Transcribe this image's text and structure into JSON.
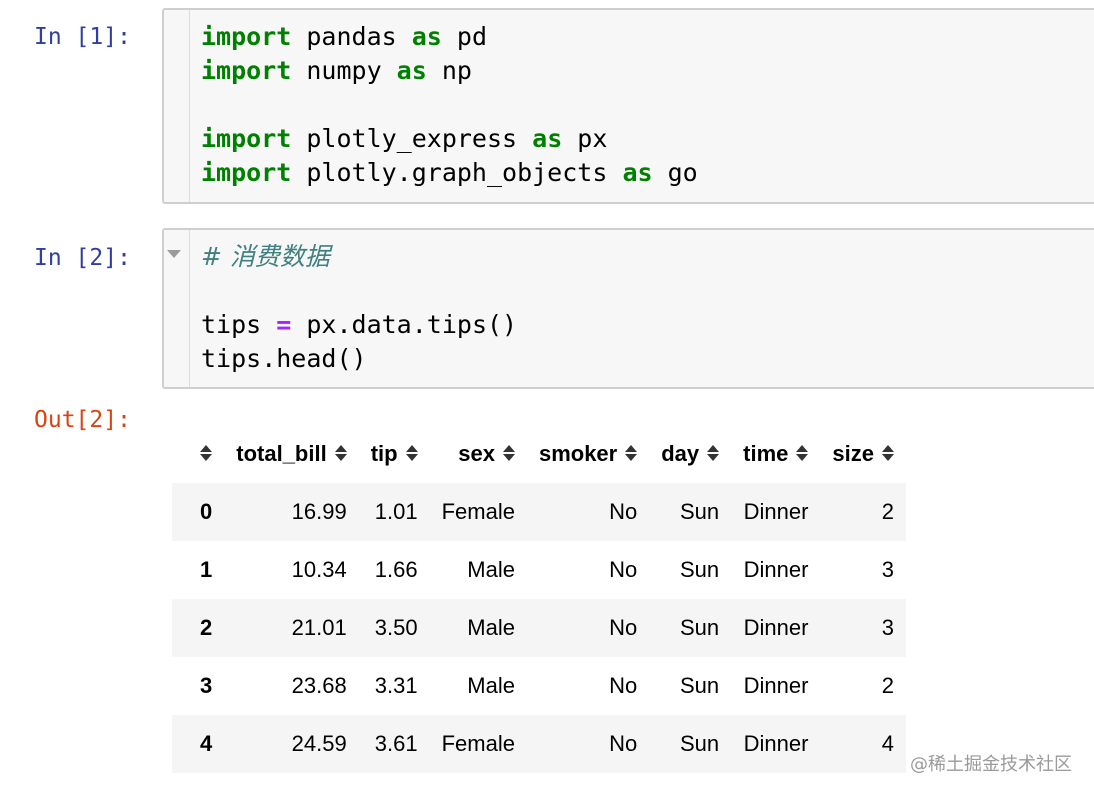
{
  "cell1": {
    "prompt": "In [1]:",
    "lines": [
      [
        {
          "t": "import",
          "c": "kw"
        },
        {
          "t": " pandas "
        },
        {
          "t": "as",
          "c": "kw"
        },
        {
          "t": " pd"
        }
      ],
      [
        {
          "t": "import",
          "c": "kw"
        },
        {
          "t": " numpy "
        },
        {
          "t": "as",
          "c": "kw"
        },
        {
          "t": " np"
        }
      ],
      [],
      [
        {
          "t": "import",
          "c": "kw"
        },
        {
          "t": " plotly_express "
        },
        {
          "t": "as",
          "c": "kw"
        },
        {
          "t": " px"
        }
      ],
      [
        {
          "t": "import",
          "c": "kw"
        },
        {
          "t": " plotly.graph_objects "
        },
        {
          "t": "as",
          "c": "kw"
        },
        {
          "t": " go"
        }
      ]
    ]
  },
  "cell2": {
    "prompt": "In [2]:",
    "lines": [
      [
        {
          "t": "# 消费数据",
          "c": "cm"
        }
      ],
      [],
      [
        {
          "t": "tips "
        },
        {
          "t": "=",
          "c": "op"
        },
        {
          "t": " px.data.tips()"
        }
      ],
      [
        {
          "t": "tips.head()"
        }
      ]
    ]
  },
  "output": {
    "prompt": "Out[2]:",
    "columns": [
      "",
      "total_bill",
      "tip",
      "sex",
      "smoker",
      "day",
      "time",
      "size"
    ],
    "rows": [
      [
        "0",
        "16.99",
        "1.01",
        "Female",
        "No",
        "Sun",
        "Dinner",
        "2"
      ],
      [
        "1",
        "10.34",
        "1.66",
        "Male",
        "No",
        "Sun",
        "Dinner",
        "3"
      ],
      [
        "2",
        "21.01",
        "3.50",
        "Male",
        "No",
        "Sun",
        "Dinner",
        "3"
      ],
      [
        "3",
        "23.68",
        "3.31",
        "Male",
        "No",
        "Sun",
        "Dinner",
        "2"
      ],
      [
        "4",
        "24.59",
        "3.61",
        "Female",
        "No",
        "Sun",
        "Dinner",
        "4"
      ]
    ]
  },
  "watermark": "@稀土掘金技术社区"
}
